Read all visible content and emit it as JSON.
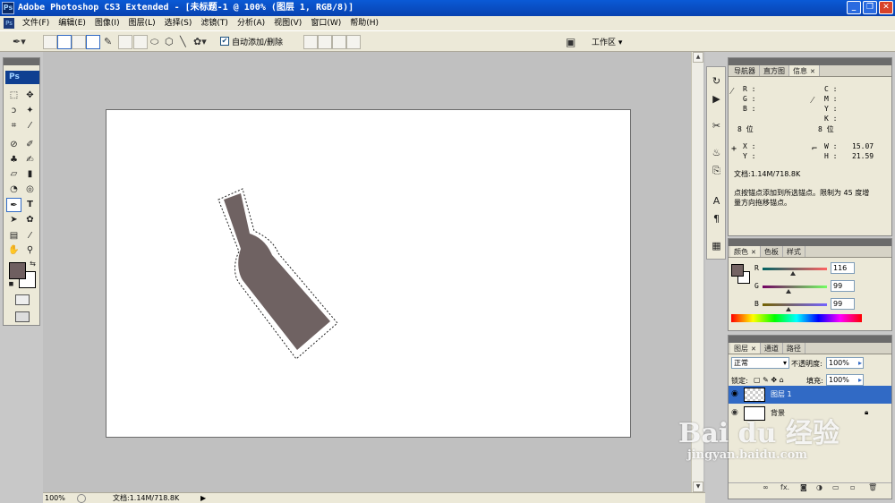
{
  "window": {
    "title": "Adobe Photoshop CS3 Extended - [未标题-1 @ 100% (图层 1, RGB/8)]",
    "icon_text": "Ps",
    "controls": [
      "_",
      "❐",
      "✕"
    ]
  },
  "menu": {
    "items": [
      "文件(F)",
      "编辑(E)",
      "图像(I)",
      "图层(L)",
      "选择(S)",
      "滤镜(T)",
      "分析(A)",
      "视图(V)",
      "窗口(W)",
      "帮助(H)"
    ]
  },
  "options_bar": {
    "auto_add_delete_label": "自动添加/删除",
    "auto_add_delete_checked": true,
    "workspace_label": "工作区 ▾"
  },
  "toolbox": {
    "logo": "Ps"
  },
  "status_bar": {
    "zoom": "100%",
    "doc_info": "文档:1.14M/718.8K"
  },
  "info_panel": {
    "tabs": [
      "导航器",
      "直方图",
      "信息"
    ],
    "active_tab": "信息",
    "rgb_labels": [
      "R :",
      "G :",
      "B :"
    ],
    "cmyk_labels": [
      "C :",
      "M :",
      "Y :",
      "K :"
    ],
    "bits_left": "8 位",
    "bits_right": "8 位",
    "x_label": "X :",
    "y_label": "Y :",
    "w_label": "W :",
    "h_label": "H :",
    "w_value": "15.07",
    "h_value": "21.59",
    "doc_info": "文档:1.14M/718.8K",
    "hint_line1": "点按锚点添加到所选锚点。限制为 45 度增",
    "hint_line2": "量方向拖移锚点。"
  },
  "color_panel": {
    "tabs": [
      "颜色",
      "色板",
      "样式"
    ],
    "active_tab": "颜色",
    "r_label": "R",
    "g_label": "G",
    "b_label": "B",
    "r_value": "116",
    "g_value": "99",
    "b_value": "99",
    "foreground_color": "#746363"
  },
  "layers_panel": {
    "tabs": [
      "图层",
      "通道",
      "路径"
    ],
    "active_tab": "图层",
    "blend_mode": "正常",
    "opacity_label": "不透明度:",
    "opacity_value": "100%",
    "lock_label": "锁定:",
    "fill_label": "填充:",
    "fill_value": "100%",
    "layers": [
      {
        "name": "图层 1",
        "selected": true
      },
      {
        "name": "背景",
        "selected": false,
        "locked": true
      }
    ]
  },
  "watermark": {
    "line1": "Bai du 经验",
    "line2": "jingyan.baidu.com"
  }
}
